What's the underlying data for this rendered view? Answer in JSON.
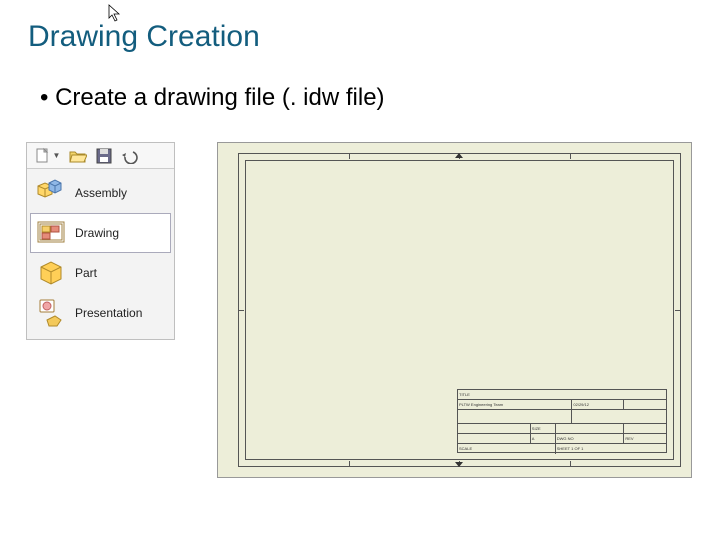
{
  "title": "Drawing Creation",
  "bullet": "•  Create a drawing file (. idw file)",
  "toolbar": {
    "new_tooltip": "New",
    "open_tooltip": "Open",
    "save_tooltip": "Save",
    "undo_tooltip": "Undo"
  },
  "menu": {
    "items": [
      {
        "label": "Assembly",
        "selected": false
      },
      {
        "label": "Drawing",
        "selected": true
      },
      {
        "label": "Part",
        "selected": false
      },
      {
        "label": "Presentation",
        "selected": false
      }
    ]
  },
  "titleblock": {
    "r1c1": "TITLE",
    "r2c1": "PLTW Engineering Team",
    "r2c2": "02/29/12",
    "r3c1": "",
    "r4c1": "",
    "r4c2": "SIZE",
    "r5c1": "",
    "r5c2": "A",
    "r5c3": "DWG NO",
    "r5c4": "REV",
    "r6c1": "SCALE",
    "r6c2": "SHEET 1 OF 1"
  }
}
